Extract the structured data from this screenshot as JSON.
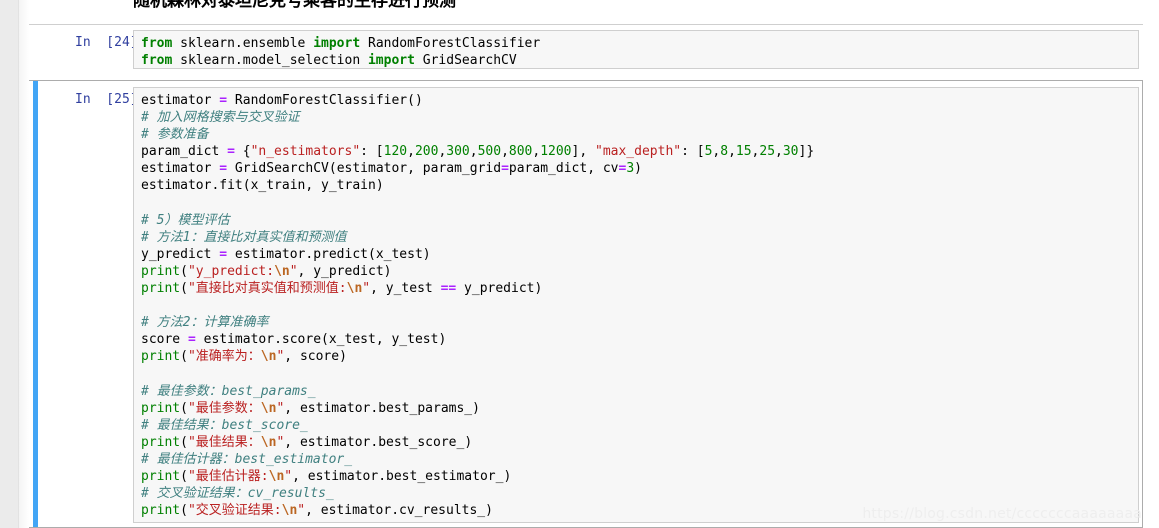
{
  "heading": {
    "text": "随机森林对泰坦尼克号乘客的生存进行预测"
  },
  "cells": [
    {
      "prompt": "In  [24]:",
      "lines": [
        [
          {
            "t": "k",
            "v": "from"
          },
          {
            "t": "n",
            "v": " sklearn.ensemble "
          },
          {
            "t": "k",
            "v": "import"
          },
          {
            "t": "n",
            "v": " RandomForestClassifier"
          }
        ],
        [
          {
            "t": "k",
            "v": "from"
          },
          {
            "t": "n",
            "v": " sklearn.model_selection "
          },
          {
            "t": "k",
            "v": "import"
          },
          {
            "t": "n",
            "v": " GridSearchCV"
          }
        ]
      ]
    },
    {
      "prompt": "In  [25]:",
      "lines": [
        [
          {
            "t": "n",
            "v": "estimator "
          },
          {
            "t": "op",
            "v": "="
          },
          {
            "t": "n",
            "v": " RandomForestClassifier"
          },
          {
            "t": "p",
            "v": "()"
          }
        ],
        [
          {
            "t": "c",
            "v": "# 加入网格搜索与交叉验证"
          }
        ],
        [
          {
            "t": "c",
            "v": "# 参数准备"
          }
        ],
        [
          {
            "t": "n",
            "v": "param_dict "
          },
          {
            "t": "op",
            "v": "="
          },
          {
            "t": "p",
            "v": " {"
          },
          {
            "t": "s",
            "v": "\"n_estimators\""
          },
          {
            "t": "p",
            "v": ": ["
          },
          {
            "t": "mi",
            "v": "120"
          },
          {
            "t": "p",
            "v": ","
          },
          {
            "t": "mi",
            "v": "200"
          },
          {
            "t": "p",
            "v": ","
          },
          {
            "t": "mi",
            "v": "300"
          },
          {
            "t": "p",
            "v": ","
          },
          {
            "t": "mi",
            "v": "500"
          },
          {
            "t": "p",
            "v": ","
          },
          {
            "t": "mi",
            "v": "800"
          },
          {
            "t": "p",
            "v": ","
          },
          {
            "t": "mi",
            "v": "1200"
          },
          {
            "t": "p",
            "v": "], "
          },
          {
            "t": "s",
            "v": "\"max_depth\""
          },
          {
            "t": "p",
            "v": ": ["
          },
          {
            "t": "mi",
            "v": "5"
          },
          {
            "t": "p",
            "v": ","
          },
          {
            "t": "mi",
            "v": "8"
          },
          {
            "t": "p",
            "v": ","
          },
          {
            "t": "mi",
            "v": "15"
          },
          {
            "t": "p",
            "v": ","
          },
          {
            "t": "mi",
            "v": "25"
          },
          {
            "t": "p",
            "v": ","
          },
          {
            "t": "mi",
            "v": "30"
          },
          {
            "t": "p",
            "v": "]}"
          }
        ],
        [
          {
            "t": "n",
            "v": "estimator "
          },
          {
            "t": "op",
            "v": "="
          },
          {
            "t": "n",
            "v": " GridSearchCV"
          },
          {
            "t": "p",
            "v": "("
          },
          {
            "t": "n",
            "v": "estimator"
          },
          {
            "t": "p",
            "v": ", "
          },
          {
            "t": "n",
            "v": "param_grid"
          },
          {
            "t": "op",
            "v": "="
          },
          {
            "t": "n",
            "v": "param_dict"
          },
          {
            "t": "p",
            "v": ", "
          },
          {
            "t": "n",
            "v": "cv"
          },
          {
            "t": "op",
            "v": "="
          },
          {
            "t": "mi",
            "v": "3"
          },
          {
            "t": "p",
            "v": ")"
          }
        ],
        [
          {
            "t": "n",
            "v": "estimator.fit"
          },
          {
            "t": "p",
            "v": "("
          },
          {
            "t": "n",
            "v": "x_train"
          },
          {
            "t": "p",
            "v": ", "
          },
          {
            "t": "n",
            "v": "y_train"
          },
          {
            "t": "p",
            "v": ")"
          }
        ],
        [],
        [
          {
            "t": "c",
            "v": "# 5）模型评估"
          }
        ],
        [
          {
            "t": "c",
            "v": "# 方法1：直接比对真实值和预测值"
          }
        ],
        [
          {
            "t": "n",
            "v": "y_predict "
          },
          {
            "t": "op",
            "v": "="
          },
          {
            "t": "n",
            "v": " estimator.predict"
          },
          {
            "t": "p",
            "v": "("
          },
          {
            "t": "n",
            "v": "x_test"
          },
          {
            "t": "p",
            "v": ")"
          }
        ],
        [
          {
            "t": "nb",
            "v": "print"
          },
          {
            "t": "p",
            "v": "("
          },
          {
            "t": "s",
            "v": "\"y_predict:"
          },
          {
            "t": "se",
            "v": "\\n"
          },
          {
            "t": "s",
            "v": "\""
          },
          {
            "t": "p",
            "v": ", "
          },
          {
            "t": "n",
            "v": "y_predict"
          },
          {
            "t": "p",
            "v": ")"
          }
        ],
        [
          {
            "t": "nb",
            "v": "print"
          },
          {
            "t": "p",
            "v": "("
          },
          {
            "t": "s",
            "v": "\"直接比对真实值和预测值:"
          },
          {
            "t": "se",
            "v": "\\n"
          },
          {
            "t": "s",
            "v": "\""
          },
          {
            "t": "p",
            "v": ", "
          },
          {
            "t": "n",
            "v": "y_test "
          },
          {
            "t": "op",
            "v": "=="
          },
          {
            "t": "n",
            "v": " y_predict"
          },
          {
            "t": "p",
            "v": ")"
          }
        ],
        [],
        [
          {
            "t": "c",
            "v": "# 方法2：计算准确率"
          }
        ],
        [
          {
            "t": "n",
            "v": "score "
          },
          {
            "t": "op",
            "v": "="
          },
          {
            "t": "n",
            "v": " estimator.score"
          },
          {
            "t": "p",
            "v": "("
          },
          {
            "t": "n",
            "v": "x_test"
          },
          {
            "t": "p",
            "v": ", "
          },
          {
            "t": "n",
            "v": "y_test"
          },
          {
            "t": "p",
            "v": ")"
          }
        ],
        [
          {
            "t": "nb",
            "v": "print"
          },
          {
            "t": "p",
            "v": "("
          },
          {
            "t": "s",
            "v": "\"准确率为："
          },
          {
            "t": "se",
            "v": "\\n"
          },
          {
            "t": "s",
            "v": "\""
          },
          {
            "t": "p",
            "v": ", "
          },
          {
            "t": "n",
            "v": "score"
          },
          {
            "t": "p",
            "v": ")"
          }
        ],
        [],
        [
          {
            "t": "c",
            "v": "# 最佳参数：best_params_"
          }
        ],
        [
          {
            "t": "nb",
            "v": "print"
          },
          {
            "t": "p",
            "v": "("
          },
          {
            "t": "s",
            "v": "\"最佳参数："
          },
          {
            "t": "se",
            "v": "\\n"
          },
          {
            "t": "s",
            "v": "\""
          },
          {
            "t": "p",
            "v": ", "
          },
          {
            "t": "n",
            "v": "estimator.best_params_"
          },
          {
            "t": "p",
            "v": ")"
          }
        ],
        [
          {
            "t": "c",
            "v": "# 最佳结果：best_score_"
          }
        ],
        [
          {
            "t": "nb",
            "v": "print"
          },
          {
            "t": "p",
            "v": "("
          },
          {
            "t": "s",
            "v": "\"最佳结果："
          },
          {
            "t": "se",
            "v": "\\n"
          },
          {
            "t": "s",
            "v": "\""
          },
          {
            "t": "p",
            "v": ", "
          },
          {
            "t": "n",
            "v": "estimator.best_score_"
          },
          {
            "t": "p",
            "v": ")"
          }
        ],
        [
          {
            "t": "c",
            "v": "# 最佳估计器：best_estimator_"
          }
        ],
        [
          {
            "t": "nb",
            "v": "print"
          },
          {
            "t": "p",
            "v": "("
          },
          {
            "t": "s",
            "v": "\"最佳估计器:"
          },
          {
            "t": "se",
            "v": "\\n"
          },
          {
            "t": "s",
            "v": "\""
          },
          {
            "t": "p",
            "v": ", "
          },
          {
            "t": "n",
            "v": "estimator.best_estimator_"
          },
          {
            "t": "p",
            "v": ")"
          }
        ],
        [
          {
            "t": "c",
            "v": "# 交叉验证结果：cv_results_"
          }
        ],
        [
          {
            "t": "nb",
            "v": "print"
          },
          {
            "t": "p",
            "v": "("
          },
          {
            "t": "s",
            "v": "\"交叉验证结果:"
          },
          {
            "t": "se",
            "v": "\\n"
          },
          {
            "t": "s",
            "v": "\""
          },
          {
            "t": "p",
            "v": ", "
          },
          {
            "t": "n",
            "v": "estimator.cv_results_"
          },
          {
            "t": "p",
            "v": ")"
          }
        ]
      ]
    }
  ],
  "watermark": {
    "text": "https://blog.csdn.net/cccccccaaaaaaaa"
  },
  "colors": {
    "selected_cell_marker": "#42a5f5",
    "prompt_text": "#303f9f",
    "keyword": "#008000",
    "string": "#ba2121",
    "comment": "#408080",
    "operator_highlight": "#aa22ff",
    "number": "#008000",
    "input_background": "#f7f7f7",
    "cell_border": "#cfcfcf"
  }
}
